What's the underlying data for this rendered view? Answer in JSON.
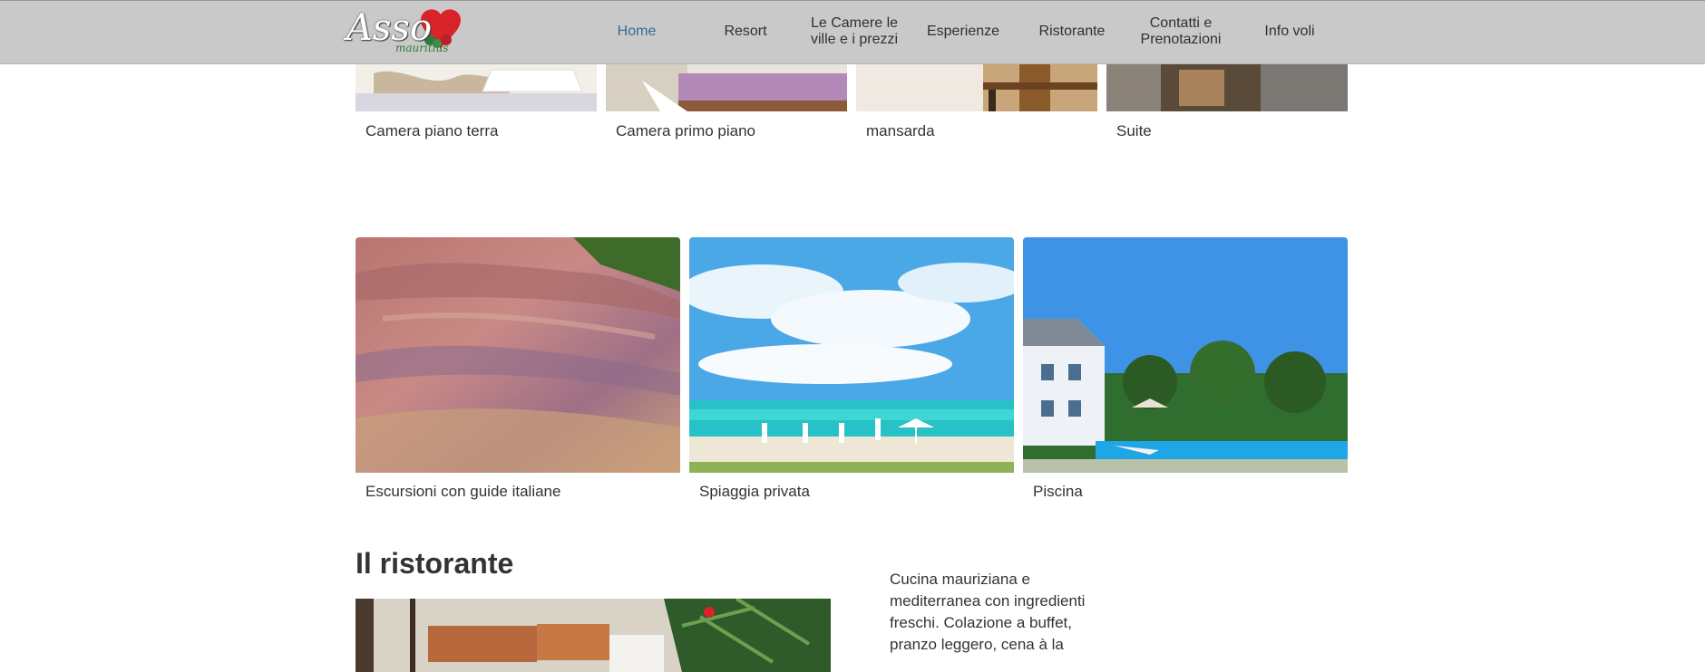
{
  "brand": {
    "logo_text": "Asso",
    "logo_subtext": "mauritius"
  },
  "nav": {
    "items": [
      {
        "label": "Home",
        "active": true
      },
      {
        "label": "Resort"
      },
      {
        "label": "Le Camere le ville e i prezzi"
      },
      {
        "label": "Esperienze"
      },
      {
        "label": "Ristorante"
      },
      {
        "label": "Contatti e Prenotazioni"
      },
      {
        "label": "Info voli"
      }
    ]
  },
  "rooms": [
    {
      "label": "Camera piano terra"
    },
    {
      "label": "Camera primo piano"
    },
    {
      "label": "mansarda"
    },
    {
      "label": "Suite"
    }
  ],
  "experiences": [
    {
      "label": "Escursioni con guide italiane"
    },
    {
      "label": "Spiaggia privata"
    },
    {
      "label": "Piscina"
    }
  ],
  "restaurant": {
    "title": "Il ristorante",
    "description": "Cucina mauriziana e mediterranea con ingredienti freschi. Colazione a buffet, pranzo leggero, cena à la"
  },
  "colors": {
    "header_bg": "#c9c9c9",
    "nav_active": "#3b6a8e",
    "heart": "#d8232a"
  }
}
